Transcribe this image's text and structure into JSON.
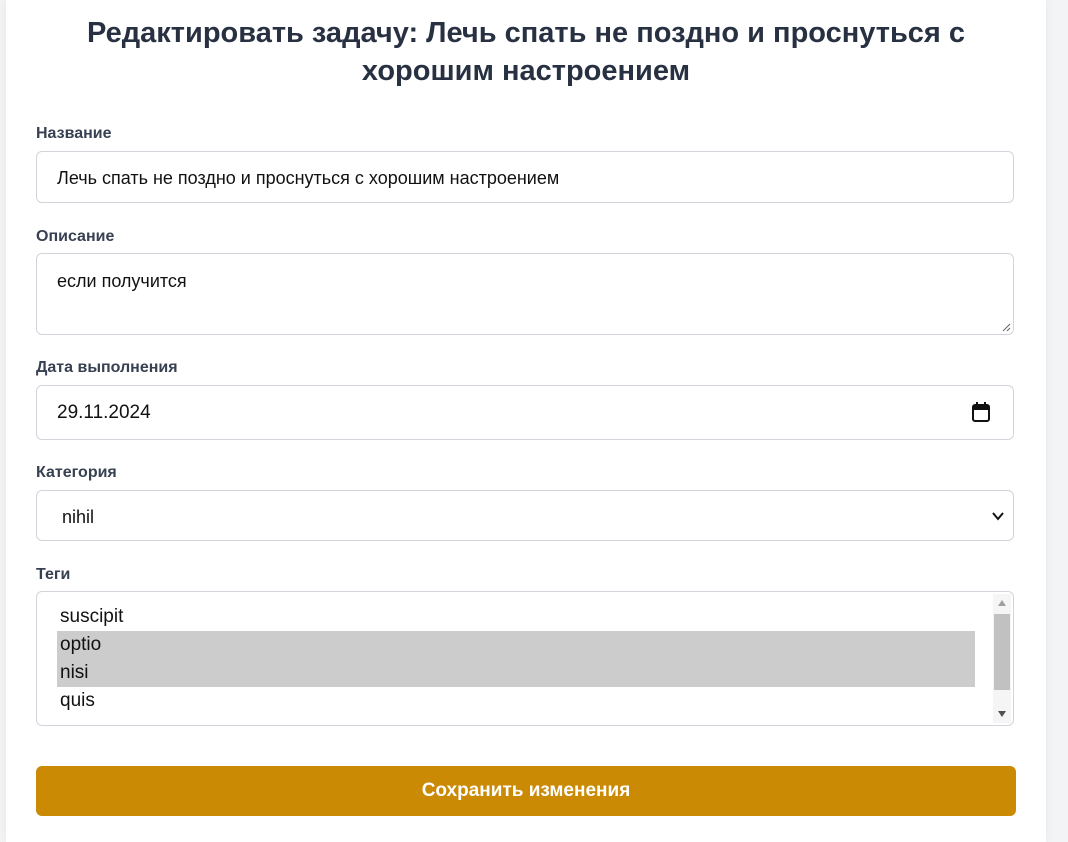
{
  "page_title": "Редактировать задачу: Лечь спать не поздно и проснуться с хорошим настроением",
  "form": {
    "name": {
      "label": "Название",
      "value": "Лечь спать не поздно и проснуться с хорошим настроением"
    },
    "description": {
      "label": "Описание",
      "value": "если получится"
    },
    "due_date": {
      "label": "Дата выполнения",
      "value": "29.11.2024",
      "icon": "calendar-icon"
    },
    "category": {
      "label": "Категория",
      "value": "nihil",
      "icon": "chevron-down-icon"
    },
    "tags": {
      "label": "Теги",
      "options": [
        {
          "label": "suscipit",
          "selected": false
        },
        {
          "label": "optio",
          "selected": true
        },
        {
          "label": "nisi",
          "selected": true
        },
        {
          "label": "quis",
          "selected": false
        }
      ]
    },
    "save_label": "Сохранить изменения"
  },
  "colors": {
    "accent": "#ca8a04",
    "selected_option": "#cccccc",
    "title": "#273142"
  }
}
